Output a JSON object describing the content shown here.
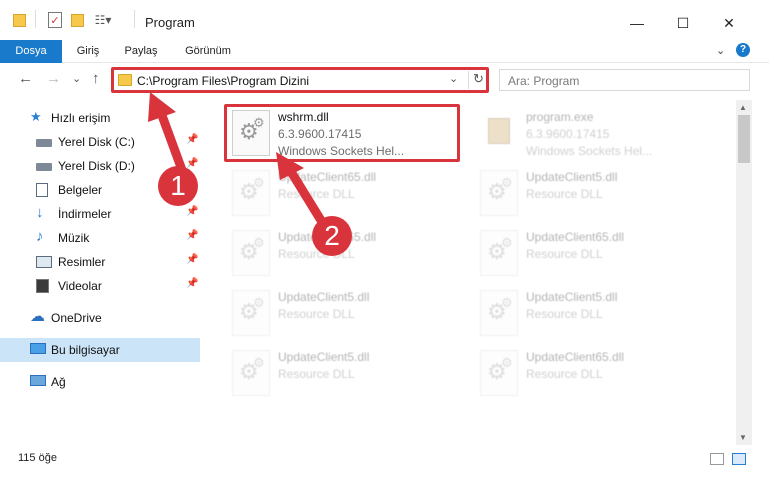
{
  "window": {
    "title": "Program",
    "controls": {
      "minimize": "—",
      "maximize": "☐",
      "close": "✕"
    }
  },
  "ribbon": {
    "tabs": [
      "Dosya",
      "Giriş",
      "Paylaş",
      "Görünüm"
    ],
    "expand": "⌄",
    "help": "?"
  },
  "nav": {
    "back": "←",
    "forward": "→",
    "down": "⌄",
    "up": "↑",
    "address": "C:\\Program Files\\Program Dizini",
    "dropdown": "⌄",
    "refresh": "↻",
    "search_placeholder": "Ara: Program"
  },
  "sidebar": {
    "items": [
      {
        "label": "Hızlı erişim",
        "icon": "star-icon",
        "pinned": false
      },
      {
        "label": "Yerel Disk (C:)",
        "icon": "drive-icon",
        "pinned": true
      },
      {
        "label": "Yerel Disk (D:)",
        "icon": "drive-icon",
        "pinned": true
      },
      {
        "label": "Belgeler",
        "icon": "document-icon",
        "pinned": true
      },
      {
        "label": "İndirmeler",
        "icon": "download-icon",
        "pinned": true
      },
      {
        "label": "Müzik",
        "icon": "music-icon",
        "pinned": true
      },
      {
        "label": "Resimler",
        "icon": "picture-icon",
        "pinned": true
      },
      {
        "label": "Videolar",
        "icon": "video-icon",
        "pinned": true
      },
      {
        "label": "OneDrive",
        "icon": "cloud-icon",
        "pinned": false
      },
      {
        "label": "Bu bilgisayar",
        "icon": "computer-icon",
        "pinned": false,
        "selected": true
      },
      {
        "label": "Ağ",
        "icon": "network-icon",
        "pinned": false
      }
    ],
    "pin_glyph": "📌"
  },
  "files": {
    "highlighted": {
      "name": "wshrm.dll",
      "version": "6.3.9600.17415",
      "description": "Windows Sockets Hel..."
    },
    "program": {
      "name": "program.exe",
      "version": "6.3.9600.17415",
      "description": "Windows Sockets Hel..."
    },
    "others": [
      {
        "name": "UpdateClient65.dll",
        "description": "Resource DLL"
      },
      {
        "name": "UpdateClient5.dll",
        "description": "Resource DLL"
      },
      {
        "name": "UpdateClient65.dll",
        "description": "Resource DLL"
      },
      {
        "name": "UpdateClient65.dll",
        "description": "Resource DLL"
      },
      {
        "name": "UpdateClient5.dll",
        "description": "Resource DLL"
      },
      {
        "name": "UpdateClient5.dll",
        "description": "Resource DLL"
      },
      {
        "name": "UpdateClient5.dll",
        "description": "Resource DLL"
      },
      {
        "name": "UpdateClient65.dll",
        "description": "Resource DLL"
      }
    ]
  },
  "status": {
    "item_count": "115 öğe"
  },
  "callouts": {
    "one": "1",
    "two": "2",
    "color": "#d9343c"
  },
  "colors": {
    "accent": "#1979ca",
    "highlight": "#d9343c",
    "selection": "#cce4f7"
  }
}
